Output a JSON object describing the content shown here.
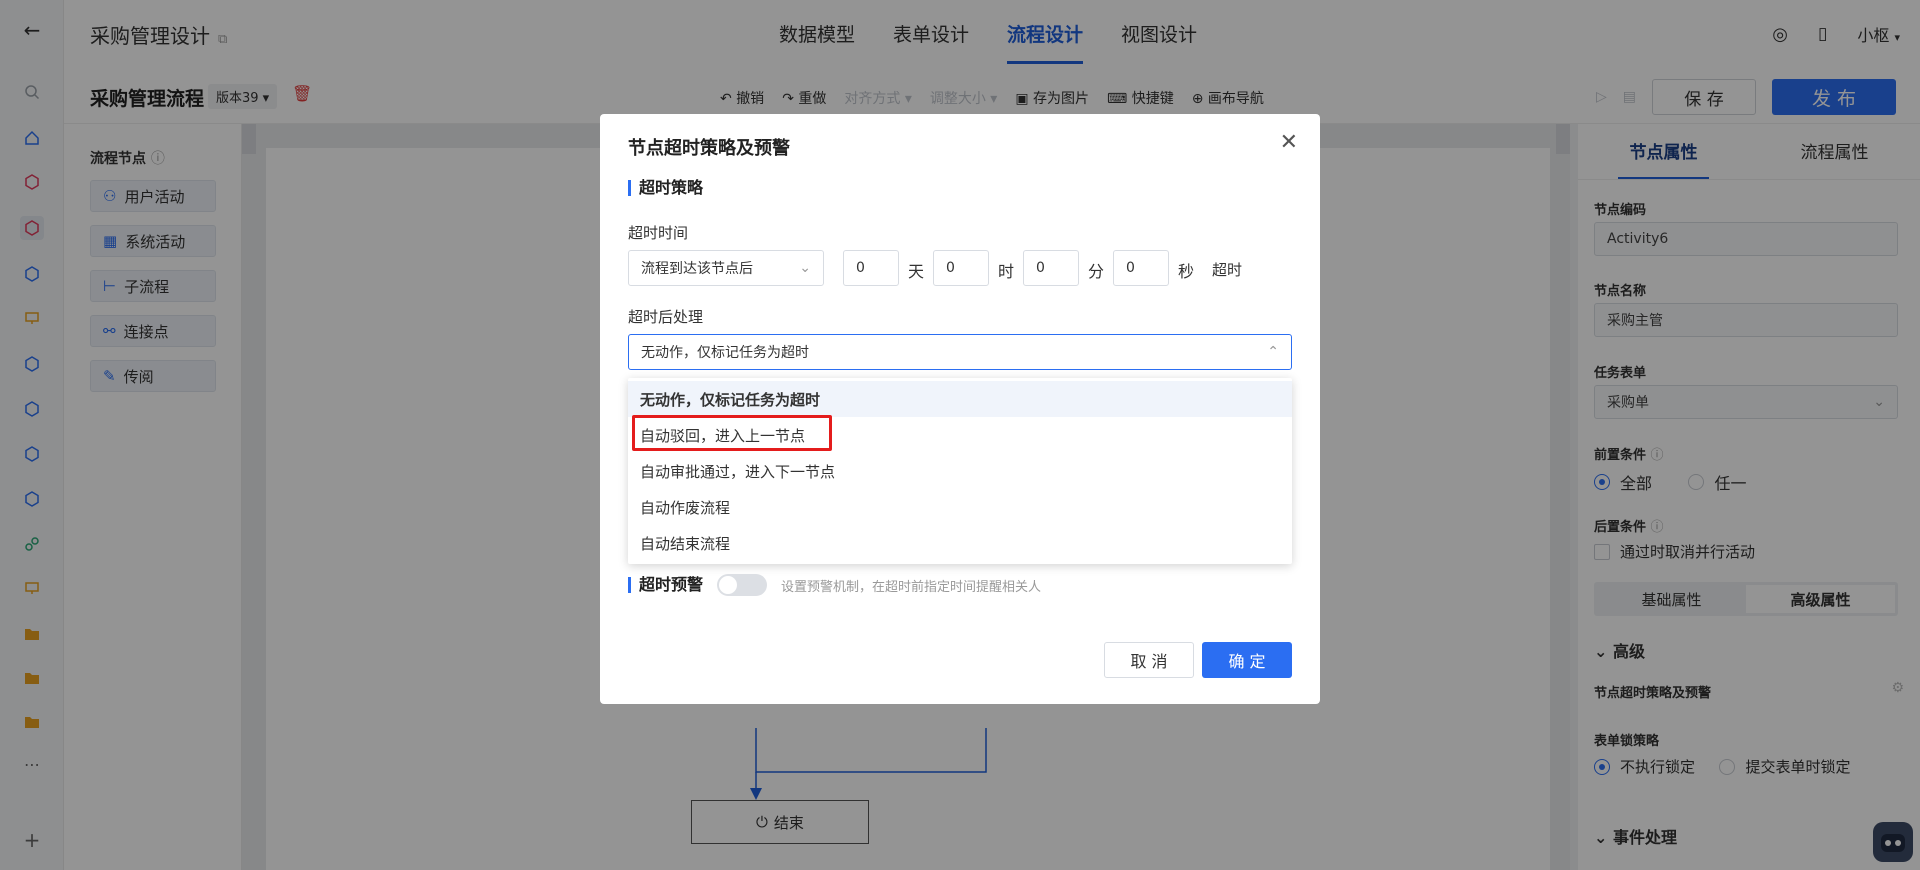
{
  "app_title": "采购管理设计",
  "top_tabs": [
    {
      "label": "数据模型"
    },
    {
      "label": "表单设计"
    },
    {
      "label": "流程设计"
    },
    {
      "label": "视图设计"
    }
  ],
  "user": {
    "name": "小枢"
  },
  "toolbar": {
    "flow_title": "采购管理流程",
    "version": "版本39",
    "undo": "撤销",
    "redo": "重做",
    "align": "对齐方式",
    "resize": "调整大小",
    "save_image": "存为图片",
    "shortcuts": "快捷键",
    "canvas_nav": "画布导航",
    "save": "保 存",
    "publish": "发 布"
  },
  "palette": {
    "title": "流程节点",
    "items": [
      {
        "label": "用户活动"
      },
      {
        "label": "系统活动"
      },
      {
        "label": "子流程"
      },
      {
        "label": "连接点"
      },
      {
        "label": "传阅"
      }
    ]
  },
  "canvas": {
    "end_node": "结束"
  },
  "right_panel": {
    "tabs": [
      {
        "label": "节点属性"
      },
      {
        "label": "流程属性"
      }
    ],
    "node_code_label": "节点编码",
    "node_code": "Activity6",
    "node_name_label": "节点名称",
    "node_name": "采购主管",
    "task_form_label": "任务表单",
    "task_form": "采购单",
    "precondition_label": "前置条件",
    "pre_all": "全部",
    "pre_any": "任一",
    "postcondition_label": "后置条件",
    "post_option": "通过时取消并行活动",
    "seg_basic": "基础属性",
    "seg_advanced": "高级属性",
    "advanced_heading": "高级",
    "timeout_item": "节点超时策略及预警",
    "form_lock_label": "表单锁策略",
    "lock_none": "不执行锁定",
    "lock_submit": "提交表单时锁定",
    "event_heading": "事件处理"
  },
  "dialog": {
    "title": "节点超时策略及预警",
    "section_strategy": "超时策略",
    "timeout_time_label": "超时时间",
    "timeout_start": "流程到达该节点后",
    "days": "0",
    "day_unit": "天",
    "hours": "0",
    "hour_unit": "时",
    "minutes": "0",
    "minute_unit": "分",
    "seconds": "0",
    "second_unit": "秒",
    "timeout_suffix": "超时",
    "after_label": "超时后处理",
    "after_value": "无动作，仅标记任务为超时",
    "options": [
      {
        "label": "无动作，仅标记任务为超时"
      },
      {
        "label": "自动驳回，进入上一节点"
      },
      {
        "label": "自动审批通过，进入下一节点"
      },
      {
        "label": "自动作废流程"
      },
      {
        "label": "自动结束流程"
      }
    ],
    "section_warning": "超时预警",
    "warning_hint": "设置预警机制，在超时前指定时间提醒相关人",
    "cancel": "取 消",
    "ok": "确 定"
  }
}
